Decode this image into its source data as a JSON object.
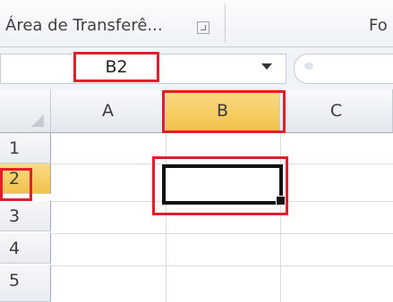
{
  "ribbon": {
    "clipboard_group_label": "Área de Transferê...",
    "font_group_label": "Fo",
    "dialog_launcher_icon": "dialog-launcher-icon"
  },
  "formula_bar": {
    "name_box_value": "B2",
    "dropdown_icon": "chevron-down-icon"
  },
  "sheet": {
    "columns": [
      "A",
      "B",
      "C"
    ],
    "rows": [
      "1",
      "2",
      "3",
      "4",
      "5"
    ],
    "active_cell": "B2"
  },
  "colors": {
    "highlight_red": "#e31d2b",
    "header_selected": "#f2c24a",
    "active_border": "#111111"
  }
}
